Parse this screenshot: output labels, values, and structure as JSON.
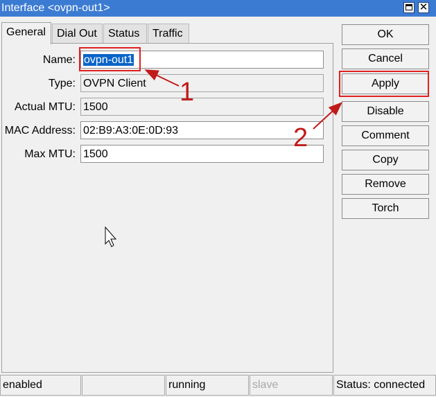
{
  "window": {
    "title": "Interface <ovpn-out1>"
  },
  "tabs": [
    {
      "label": "General"
    },
    {
      "label": "Dial Out"
    },
    {
      "label": "Status"
    },
    {
      "label": "Traffic"
    }
  ],
  "form": {
    "name": {
      "label": "Name:",
      "value": "ovpn-out1"
    },
    "type": {
      "label": "Type:",
      "value": "OVPN Client"
    },
    "actual_mtu": {
      "label": "Actual MTU:",
      "value": "1500"
    },
    "mac_address": {
      "label": "MAC Address:",
      "value": "02:B9:A3:0E:0D:93"
    },
    "max_mtu": {
      "label": "Max MTU:",
      "value": "1500"
    }
  },
  "buttons": {
    "ok": "OK",
    "cancel": "Cancel",
    "apply": "Apply",
    "disable": "Disable",
    "comment": "Comment",
    "copy": "Copy",
    "remove": "Remove",
    "torch": "Torch"
  },
  "annotations": {
    "step1": "1",
    "step2": "2",
    "color": "#c11a1a"
  },
  "statusbar": {
    "enabled": "enabled",
    "blank": "",
    "running": "running",
    "slave": "slave",
    "status": "Status: connected"
  }
}
